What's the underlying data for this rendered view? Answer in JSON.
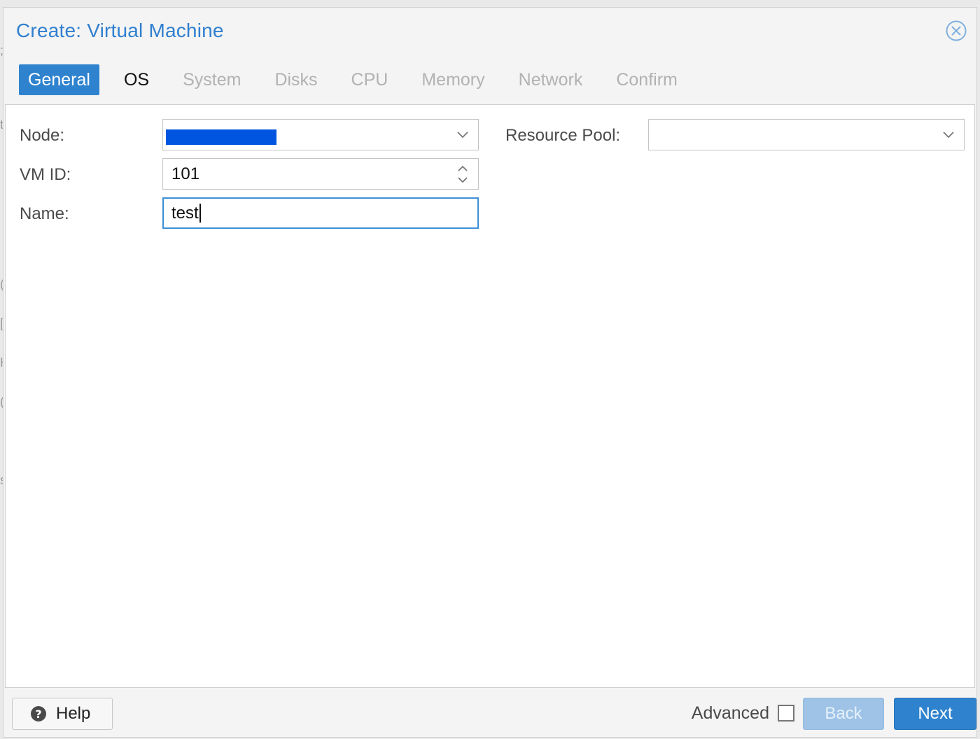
{
  "dialog": {
    "title": "Create: Virtual Machine",
    "close_icon": "close-circle-icon"
  },
  "tabs": [
    {
      "label": "General",
      "state": "active"
    },
    {
      "label": "OS",
      "state": "enabled"
    },
    {
      "label": "System",
      "state": "disabled"
    },
    {
      "label": "Disks",
      "state": "disabled"
    },
    {
      "label": "CPU",
      "state": "disabled"
    },
    {
      "label": "Memory",
      "state": "disabled"
    },
    {
      "label": "Network",
      "state": "disabled"
    },
    {
      "label": "Confirm",
      "state": "disabled"
    }
  ],
  "form": {
    "node": {
      "label": "Node:",
      "value": "",
      "redacted": true
    },
    "vmid": {
      "label": "VM ID:",
      "value": "101"
    },
    "name": {
      "label": "Name:",
      "value": "test"
    },
    "resource_pool": {
      "label": "Resource Pool:",
      "value": ""
    }
  },
  "footer": {
    "help_label": "Help",
    "help_icon": "question-circle-icon",
    "advanced_label": "Advanced",
    "advanced_checked": false,
    "back_label": "Back",
    "next_label": "Next"
  },
  "colors": {
    "accent": "#2f83ce",
    "title": "#2f7fcf",
    "redaction": "#0055e0"
  }
}
